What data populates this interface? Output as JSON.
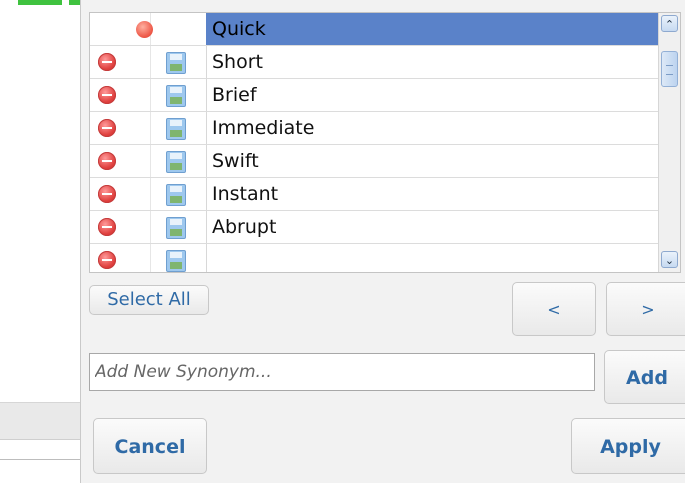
{
  "header_row": {
    "text": "Quick"
  },
  "synonyms": [
    {
      "text": "Short"
    },
    {
      "text": "Brief"
    },
    {
      "text": "Immediate"
    },
    {
      "text": "Swift"
    },
    {
      "text": "Instant"
    },
    {
      "text": "Abrupt"
    }
  ],
  "scrollbar": {
    "up_label": "⌃",
    "down_label": "⌄"
  },
  "buttons": {
    "select_all": "Select All",
    "prev": "<",
    "next": ">",
    "add": "Add",
    "cancel": "Cancel",
    "apply": "Apply"
  },
  "new_synonym": {
    "placeholder": "Add New Synonym...",
    "value": ""
  },
  "icons": {
    "remove": "remove-circle-icon",
    "save": "floppy-disk-icon",
    "header": "red-dot-icon"
  },
  "colors": {
    "header_bg": "#5a82c9",
    "button_text": "#2f6aa6",
    "background_tab": "#3fc23f"
  }
}
